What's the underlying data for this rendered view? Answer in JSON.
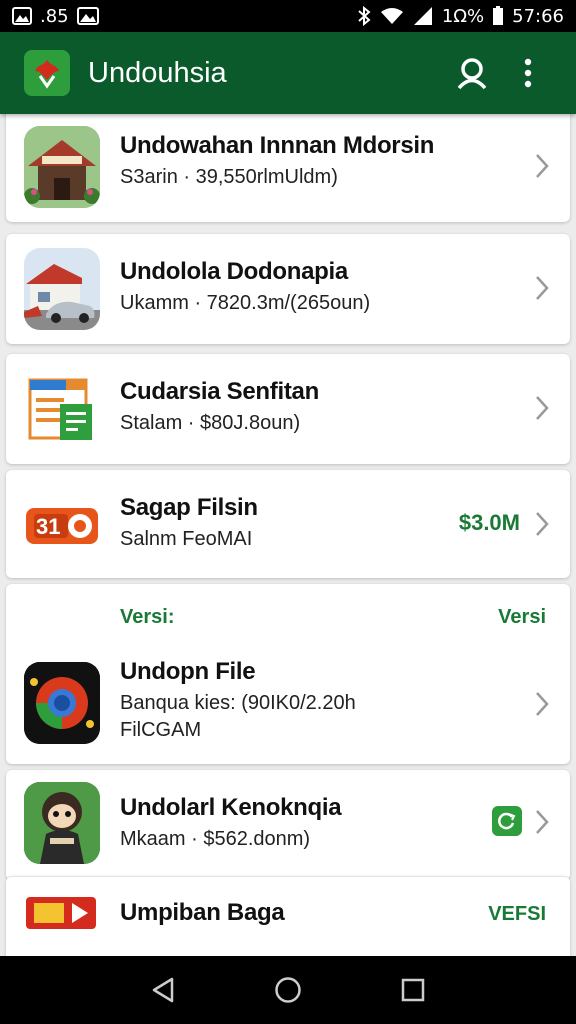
{
  "status_bar": {
    "left_text": ".85",
    "battery_pct": "1Ω%",
    "time": "57:66"
  },
  "app_bar": {
    "title": "Undouhsia",
    "icons": [
      "app-logo-icon",
      "search-icon",
      "more-vert-icon"
    ]
  },
  "items": [
    {
      "title": "Undowahan Innnan Mdorsin",
      "subtitle": "S3arin  ·  39,550rlmUldm)",
      "icon": "house-icon"
    },
    {
      "title": "Undolola Dodonapia",
      "subtitle": "Ukamm  · 7820.3m/(265oun)",
      "icon": "car-garage-icon"
    },
    {
      "title": "Cudarsia Senfitan",
      "subtitle": "Stalam  · $80J.8oun)",
      "icon": "document-icon"
    },
    {
      "title": "Sagap Filsin",
      "subtitle": "Salnm FeoMAI",
      "price": "$3.0M",
      "icon": "ticket-icon",
      "icon_text": "31"
    },
    {
      "header_left": "Versi:",
      "header_right": "Versi",
      "title": "Undopn File",
      "subtitle": "Banqua kies: (90IK0/2.20h",
      "subtitle2": "FilCGAM",
      "icon": "browser-icon"
    },
    {
      "title": "Undolarl Kenoknqia",
      "subtitle": "Mkaam  · $562.donm)",
      "icon": "character-icon",
      "badge_icon": "refresh-icon"
    },
    {
      "title": "Umpiban Baga",
      "versi": "VEFSI",
      "icon": "game-icon"
    }
  ],
  "colors": {
    "app_bar": "#0b5a2c",
    "accent_green": "#1a7a35",
    "background": "#ececec"
  }
}
